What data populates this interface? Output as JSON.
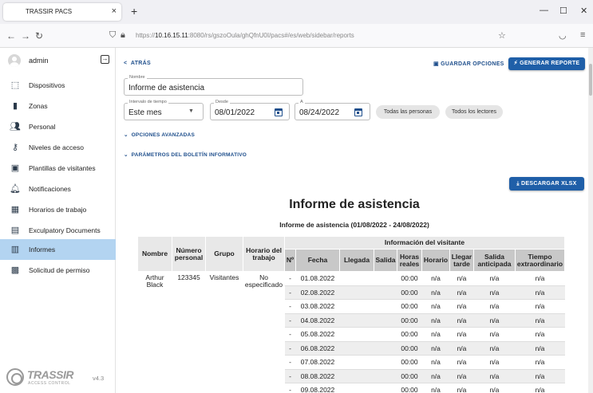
{
  "browser": {
    "tab_title": "TRASSIR PACS",
    "tab_close": "×",
    "new_tab": "+",
    "url_prefix": "https://",
    "url_host": "10.16.15.11",
    "url_path": ":8080/rs/gszoOula/ghQfnU0I/pacs#/es/web/sidebar/reports"
  },
  "sidebar": {
    "user": "admin",
    "items": [
      {
        "label": "Dispositivos",
        "icon": "device-icon"
      },
      {
        "label": "Zonas",
        "icon": "door-icon"
      },
      {
        "label": "Personal",
        "icon": "people-icon"
      },
      {
        "label": "Niveles de acceso",
        "icon": "key-icon"
      },
      {
        "label": "Plantillas de visitantes",
        "icon": "template-icon"
      },
      {
        "label": "Notificaciones",
        "icon": "bell-icon"
      },
      {
        "label": "Horarios de trabajo",
        "icon": "calendar-icon"
      },
      {
        "label": "Exculpatory Documents",
        "icon": "document-icon"
      },
      {
        "label": "Informes",
        "icon": "report-icon",
        "active": true
      },
      {
        "label": "Solicitud de permiso",
        "icon": "permission-icon"
      }
    ],
    "logo_text": "TRASSIR",
    "logo_sub": "ACCESS CONTROL",
    "version": "v4.3"
  },
  "toolbar": {
    "back": "ATRÁS",
    "save_options": "GUARDAR OPCIONES",
    "generate": "GENERAR REPORTE"
  },
  "form": {
    "name_legend": "Nombre",
    "name_value": "Informe de asistencia",
    "interval_legend": "Intervalo de tiempo",
    "interval_value": "Este mes",
    "from_legend": "Desde",
    "from_value": "08/01/2022",
    "to_legend": "A",
    "to_value": "08/24/2022",
    "all_people": "Todas las personas",
    "all_readers": "Todos los lectores",
    "advanced": "OPCIONES AVANZADAS",
    "newsletter": "PARÁMETROS DEL BOLETÍN INFORMATIVO"
  },
  "report": {
    "download": "DESCARGAR XLSX",
    "title": "Informe de asistencia",
    "subtitle": "Informe de asistencia (01/08/2022 - 24/08/2022)",
    "headers": {
      "name": "Nombre",
      "personal_number": "Número personal",
      "group": "Grupo",
      "schedule": "Horario del trabajo",
      "visitor_info": "Información del visitante",
      "no": "Nº",
      "date": "Fecha",
      "arrival": "Llegada",
      "departure": "Salida",
      "real_hours": "Horas reales",
      "schedule2": "Horario",
      "late": "Llegar tarde",
      "early_exit": "Salida anticipada",
      "overtime": "Tiempo extraordinario"
    },
    "person": {
      "name": "Arthur Black",
      "number": "123345",
      "group": "Visitantes",
      "schedule": "No especificado"
    },
    "rows": [
      {
        "no": "-",
        "date": "01.08.2022",
        "arrival": "",
        "departure": "",
        "hours": "00:00",
        "schedule": "n/a",
        "late": "n/a",
        "early": "n/a",
        "overtime": "n/a"
      },
      {
        "no": "-",
        "date": "02.08.2022",
        "arrival": "",
        "departure": "",
        "hours": "00:00",
        "schedule": "n/a",
        "late": "n/a",
        "early": "n/a",
        "overtime": "n/a"
      },
      {
        "no": "-",
        "date": "03.08.2022",
        "arrival": "",
        "departure": "",
        "hours": "00:00",
        "schedule": "n/a",
        "late": "n/a",
        "early": "n/a",
        "overtime": "n/a"
      },
      {
        "no": "-",
        "date": "04.08.2022",
        "arrival": "",
        "departure": "",
        "hours": "00:00",
        "schedule": "n/a",
        "late": "n/a",
        "early": "n/a",
        "overtime": "n/a"
      },
      {
        "no": "-",
        "date": "05.08.2022",
        "arrival": "",
        "departure": "",
        "hours": "00:00",
        "schedule": "n/a",
        "late": "n/a",
        "early": "n/a",
        "overtime": "n/a"
      },
      {
        "no": "-",
        "date": "06.08.2022",
        "arrival": "",
        "departure": "",
        "hours": "00:00",
        "schedule": "n/a",
        "late": "n/a",
        "early": "n/a",
        "overtime": "n/a"
      },
      {
        "no": "-",
        "date": "07.08.2022",
        "arrival": "",
        "departure": "",
        "hours": "00:00",
        "schedule": "n/a",
        "late": "n/a",
        "early": "n/a",
        "overtime": "n/a"
      },
      {
        "no": "-",
        "date": "08.08.2022",
        "arrival": "",
        "departure": "",
        "hours": "00:00",
        "schedule": "n/a",
        "late": "n/a",
        "early": "n/a",
        "overtime": "n/a"
      },
      {
        "no": "-",
        "date": "09.08.2022",
        "arrival": "",
        "departure": "",
        "hours": "00:00",
        "schedule": "n/a",
        "late": "n/a",
        "early": "n/a",
        "overtime": "n/a"
      }
    ]
  },
  "colors": {
    "accent": "#1f5fa8",
    "active_nav": "#b3d4f1",
    "header_gray": "#e8e8e8",
    "subheader_gray": "#c8c8c8"
  }
}
